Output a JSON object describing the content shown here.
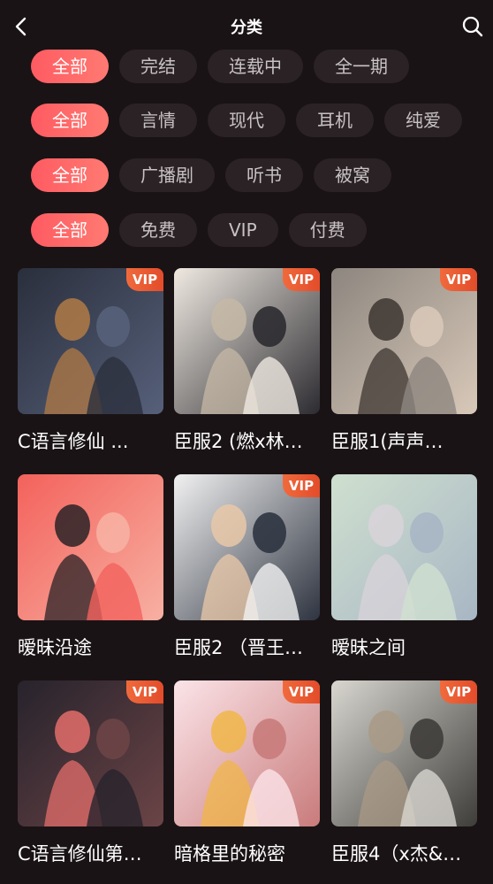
{
  "header": {
    "title": "分类"
  },
  "filters": [
    {
      "options": [
        "全部",
        "完结",
        "连载中",
        "全一期"
      ],
      "selected": 0
    },
    {
      "options": [
        "全部",
        "言情",
        "现代",
        "耳机",
        "纯爱"
      ],
      "selected": 0
    },
    {
      "options": [
        "全部",
        "广播剧",
        "听书",
        "被窝"
      ],
      "selected": 0
    },
    {
      "options": [
        "全部",
        "免费",
        "VIP",
        "付费"
      ],
      "selected": 0
    }
  ],
  "items": [
    {
      "title": "C语言修仙 ...",
      "vip": "VIP",
      "palette": [
        "#2a2f3c",
        "#56607a",
        "#b17a45"
      ]
    },
    {
      "title": "臣服2 (燃x林…",
      "vip": "VIP",
      "palette": [
        "#efe9e1",
        "#2c2b30",
        "#c5b8a6"
      ]
    },
    {
      "title": "臣服1(声声…",
      "vip": "VIP",
      "palette": [
        "#8d867f",
        "#d8c8b8",
        "#3d3631"
      ]
    },
    {
      "title": "暧昧沿途",
      "vip": "",
      "palette": [
        "#f3625c",
        "#f7b0a2",
        "#2a2226"
      ]
    },
    {
      "title": "臣服2 （晋王…",
      "vip": "VIP",
      "palette": [
        "#f1f1f1",
        "#2e3440",
        "#e9c8a8"
      ]
    },
    {
      "title": "暧昧之间",
      "vip": "",
      "palette": [
        "#cfe0cf",
        "#a8b6c4",
        "#d9d3d9"
      ]
    },
    {
      "title": "C语言修仙第…",
      "vip": "VIP",
      "palette": [
        "#27232c",
        "#6b4446",
        "#e36d6b"
      ]
    },
    {
      "title": "暗格里的秘密",
      "vip": "VIP",
      "palette": [
        "#fbe4e8",
        "#c97b7b",
        "#f0b648"
      ]
    },
    {
      "title": "臣服4（x杰&…",
      "vip": "VIP",
      "palette": [
        "#d8d6cf",
        "#3f3d3a",
        "#a99a86"
      ]
    }
  ]
}
